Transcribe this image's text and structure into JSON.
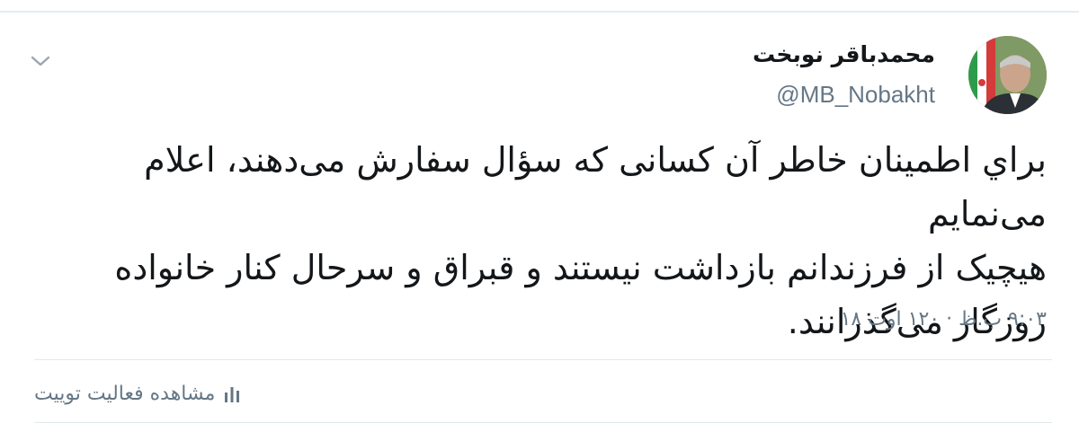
{
  "user": {
    "display_name": "محمدباقر نوبخت",
    "handle": "@MB_Nobakht"
  },
  "tweet": {
    "lines": [
      "براي اطمینان خاطر آن کسانی که سؤال سفارش می‌دهند، اعلام می‌نمایم",
      "هیچیک از فرزندانم بازداشت نیستند و قبراق و سرحال کنار خانواده",
      "روزگار می‌گذرانند."
    ],
    "timestamp": "۹:۰۳ ب.ظ · ۱۲۰ اوت ۱۸"
  },
  "actions": {
    "view_activity_label": "مشاهده فعالیت توییت"
  },
  "icons": {
    "menu": "chevron-down-icon",
    "activity": "bar-chart-icon"
  },
  "colors": {
    "text": "#14171a",
    "secondary": "#657786",
    "divider": "#e1e8ed"
  }
}
